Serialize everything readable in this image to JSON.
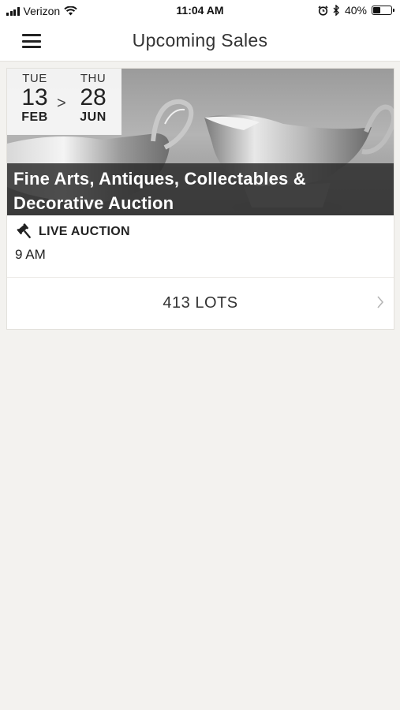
{
  "status_bar": {
    "carrier": "Verizon",
    "time": "11:04 AM",
    "battery": "40%",
    "battery_level": 0.4,
    "icons": [
      "signal-icon",
      "wifi-icon",
      "alarm-icon",
      "bluetooth-icon",
      "battery-icon"
    ]
  },
  "nav": {
    "title": "Upcoming Sales",
    "menu_icon": "hamburger-menu-icon"
  },
  "sale": {
    "start": {
      "dow": "TUE",
      "day": "13",
      "month": "FEB"
    },
    "separator": ">",
    "end": {
      "dow": "THU",
      "day": "28",
      "month": "JUN"
    },
    "title": "Fine Arts, Antiques, Collectables & Decorative Auction",
    "auction_type": "LIVE AUCTION",
    "auction_icon": "gavel-icon",
    "time": "9 AM",
    "lots": "413 LOTS",
    "image": "silver-sauce-boats-photo"
  },
  "colors": {
    "background": "#f3f2ef",
    "card": "#ffffff",
    "title_band": "#282828"
  }
}
